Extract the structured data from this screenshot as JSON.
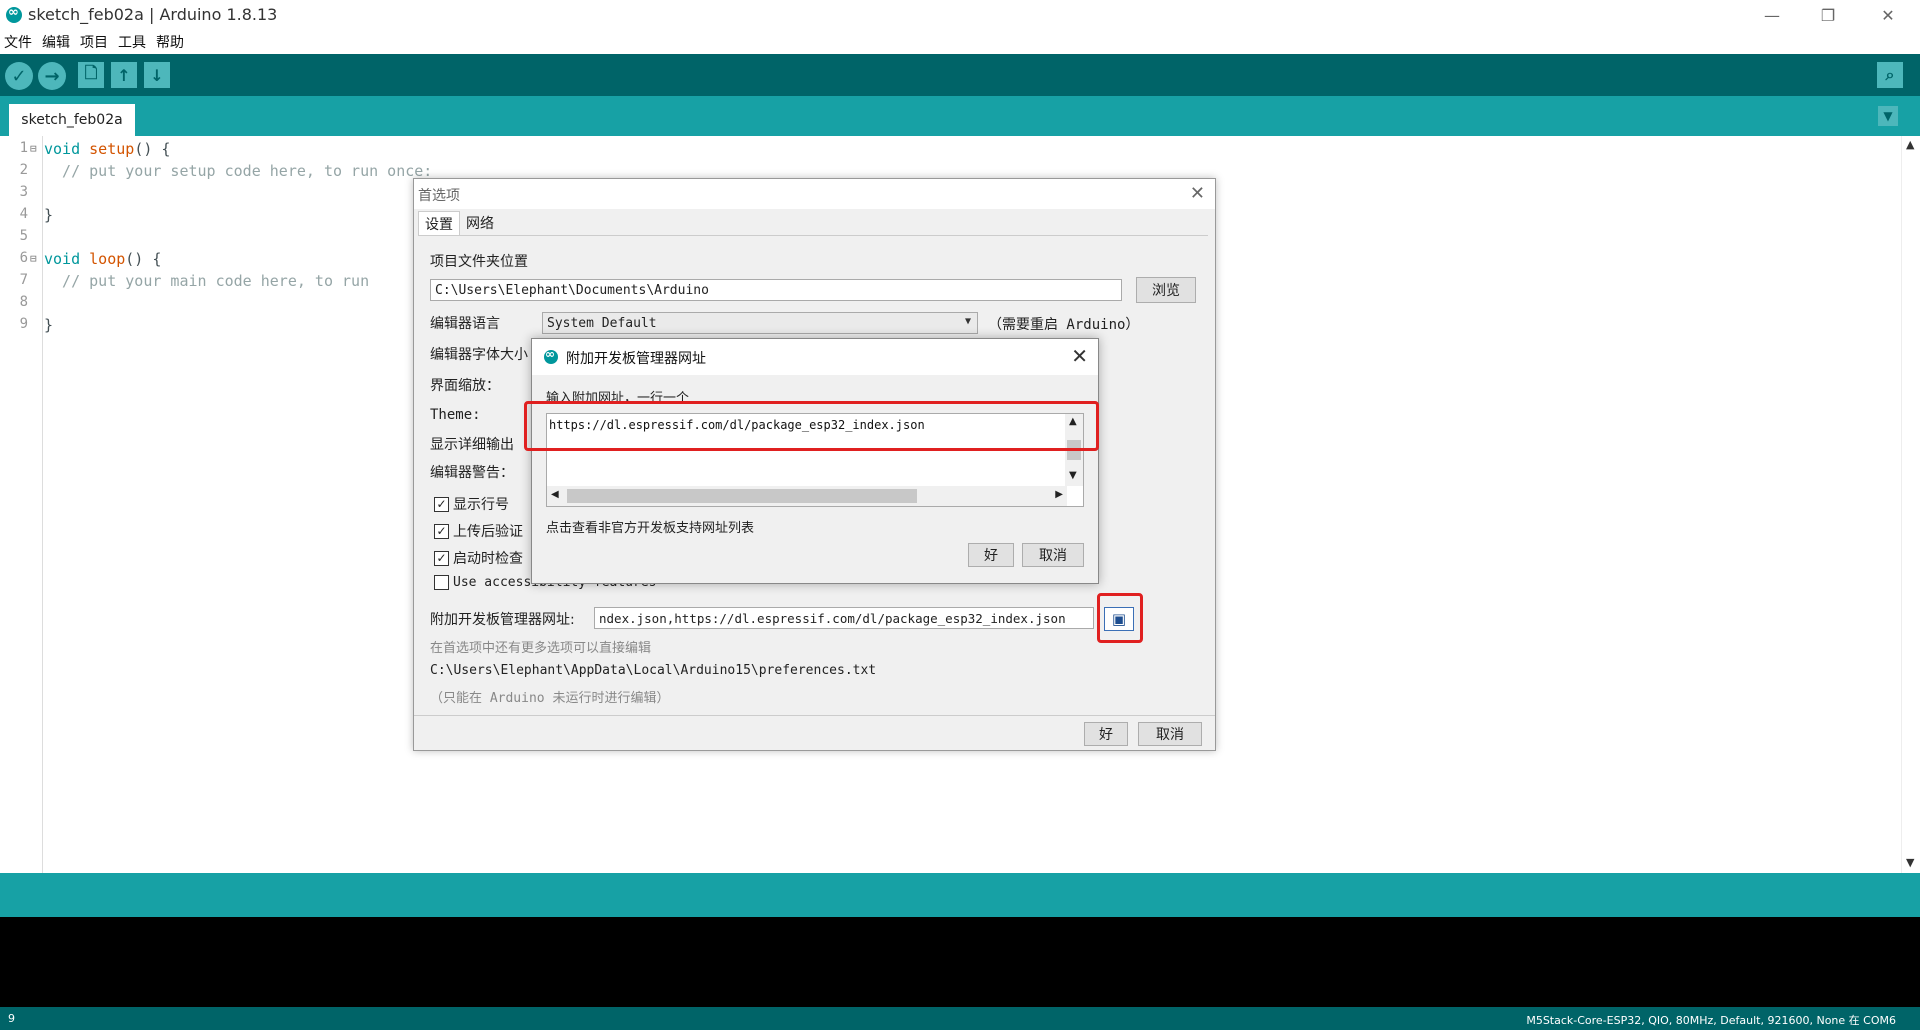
{
  "window": {
    "title": "sketch_feb02a | Arduino 1.8.13",
    "minimize": "—",
    "restore": "❐",
    "close": "✕"
  },
  "menu": [
    "文件",
    "编辑",
    "项目",
    "工具",
    "帮助"
  ],
  "toolbar": {
    "verify_icon": "✓",
    "upload_icon": "→",
    "new_icon": "🗋",
    "open_icon": "↑",
    "save_icon": "↓",
    "serial_icon": "⌕"
  },
  "tabs": {
    "active": "sketch_feb02a",
    "menu_icon": "▼"
  },
  "code_lines": [
    {
      "n": "1",
      "fold": "⊟"
    },
    {
      "n": "2"
    },
    {
      "n": "3"
    },
    {
      "n": "4"
    },
    {
      "n": "5"
    },
    {
      "n": "6",
      "fold": "⊟"
    },
    {
      "n": "7"
    },
    {
      "n": "8"
    },
    {
      "n": "9"
    }
  ],
  "code": {
    "l1_kw": "void",
    "l1_fn": "setup",
    "l1_rest": "() {",
    "l2": "  // put your setup code here, to run once:",
    "l4": "}",
    "l6_kw": "void",
    "l6_fn": "loop",
    "l6_rest": "() {",
    "l7": "  // put your main code here, to run",
    "l9": "}"
  },
  "prefs": {
    "title": "首选项",
    "tab_settings": "设置",
    "tab_network": "网络",
    "sketchbook_label": "项目文件夹位置",
    "sketchbook_value": "C:\\Users\\Elephant\\Documents\\Arduino",
    "browse": "浏览",
    "lang_label": "编辑器语言",
    "lang_value": "System Default",
    "lang_note": "（需要重启 Arduino）",
    "font_label": "编辑器字体大小",
    "scale_label": "界面缩放：",
    "theme_label": "Theme:",
    "verbose_label": "显示详细输出",
    "warnings_label": "编辑器警告：",
    "chk_linenumbers": "显示行号",
    "chk_verify": "上传后验证",
    "chk_updates": "启动时检查",
    "chk_accessibility": "Use accessibility features",
    "urls_label": "附加开发板管理器网址:",
    "urls_value": "ndex.json,https://dl.espressif.com/dl/package_esp32_index.json",
    "more_prefs": "在首选项中还有更多选项可以直接编辑",
    "prefs_path": "C:\\Users\\Elephant\\AppData\\Local\\Arduino15\\preferences.txt",
    "prefs_note": "（只能在 Arduino 未运行时进行编辑）",
    "ok": "好",
    "cancel": "取消"
  },
  "urldlg": {
    "title": "附加开发板管理器网址",
    "instruction": "输入附加网址，一行一个",
    "url": "https://dl.espressif.com/dl/package_esp32_index.json",
    "link": "点击查看非官方开发板支持网址列表",
    "ok": "好",
    "cancel": "取消"
  },
  "footer": {
    "line": "9",
    "board": "M5Stack-Core-ESP32, QIO, 80MHz, Default, 921600, None 在 COM6"
  },
  "colors": {
    "toolbar": "#006468",
    "tabrow": "#17a1a5",
    "highlight": "#e02020"
  }
}
